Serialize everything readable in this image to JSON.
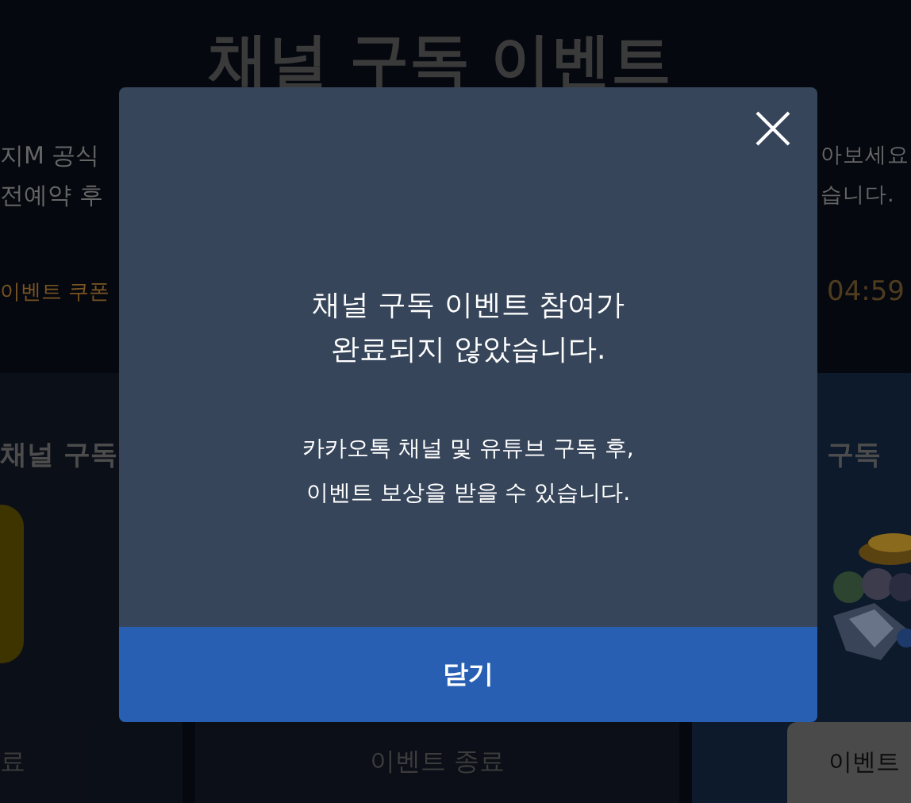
{
  "background": {
    "title": "채널 구독 이벤트",
    "intro_left": [
      "지M 공식",
      "전예약 후"
    ],
    "intro_right": [
      "아보세요",
      "습니다."
    ],
    "coupon_label": "이벤트 쿠폰",
    "timer": "04:59",
    "cards": [
      {
        "kind": "tile",
        "heading": "채널 구독",
        "button": "료",
        "disabled": true
      },
      {
        "kind": "plain",
        "button": "이벤트 종료",
        "disabled": true
      },
      {
        "kind": "picture",
        "heading": "구독",
        "button": "이벤트",
        "disabled": false
      }
    ]
  },
  "dialog": {
    "title": "채널 구독 이벤트 참여가\n완료되지 않았습니다.",
    "message": "카카오톡 채널 및 유튜브 구독 후,\n이벤트 보상을 받을 수 있습니다.",
    "close_button": "닫기"
  }
}
